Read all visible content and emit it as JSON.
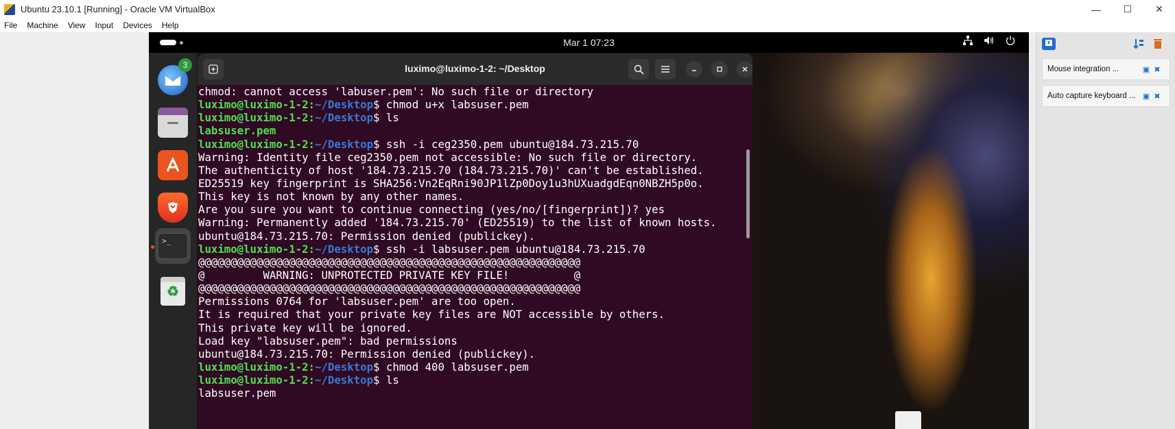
{
  "host_window": {
    "title": "Ubuntu 23.10.1 [Running] - Oracle VM VirtualBox",
    "controls": [
      "—",
      "☐",
      "✕"
    ]
  },
  "host_menu": [
    "File",
    "Machine",
    "View",
    "Input",
    "Devices",
    "Help"
  ],
  "guest_topbar": {
    "clock": "Mar 1  07:23",
    "tray_icons": [
      "network-icon",
      "volume-icon",
      "power-icon"
    ]
  },
  "dock": {
    "items": [
      {
        "name": "thunderbird",
        "badge": "3"
      },
      {
        "name": "files"
      },
      {
        "name": "app-center"
      },
      {
        "name": "brave-browser"
      },
      {
        "name": "terminal",
        "active": true
      },
      {
        "name": "trash"
      }
    ]
  },
  "terminal": {
    "title": "luximo@luximo-1-2: ~/Desktop",
    "prompt_user": "luximo@luximo-1-2",
    "prompt_path": "~/Desktop",
    "lines": [
      {
        "type": "out",
        "text": "chmod: cannot access 'labuser.pem': No such file or directory"
      },
      {
        "type": "cmd",
        "text": " chmod u+x labsuser.pem"
      },
      {
        "type": "cmd",
        "text": " ls"
      },
      {
        "type": "file",
        "text": "labsuser.pem"
      },
      {
        "type": "cmd",
        "text": " ssh -i ceg2350.pem ubuntu@184.73.215.70"
      },
      {
        "type": "out",
        "text": "Warning: Identity file ceg2350.pem not accessible: No such file or directory."
      },
      {
        "type": "out",
        "text": "The authenticity of host '184.73.215.70 (184.73.215.70)' can't be established."
      },
      {
        "type": "out",
        "text": "ED25519 key fingerprint is SHA256:Vn2EqRni90JP1lZp0Doy1u3hUXuadgdEqn0NBZH5p0o."
      },
      {
        "type": "out",
        "text": "This key is not known by any other names."
      },
      {
        "type": "out",
        "text": "Are you sure you want to continue connecting (yes/no/[fingerprint])? yes"
      },
      {
        "type": "out",
        "text": "Warning: Permanently added '184.73.215.70' (ED25519) to the list of known hosts."
      },
      {
        "type": "out",
        "text": "ubuntu@184.73.215.70: Permission denied (publickey)."
      },
      {
        "type": "cmd",
        "text": " ssh -i labsuser.pem ubuntu@184.73.215.70"
      },
      {
        "type": "out",
        "text": "@@@@@@@@@@@@@@@@@@@@@@@@@@@@@@@@@@@@@@@@@@@@@@@@@@@@@@@@@@@"
      },
      {
        "type": "out",
        "text": "@         WARNING: UNPROTECTED PRIVATE KEY FILE!          @"
      },
      {
        "type": "out",
        "text": "@@@@@@@@@@@@@@@@@@@@@@@@@@@@@@@@@@@@@@@@@@@@@@@@@@@@@@@@@@@"
      },
      {
        "type": "out",
        "text": "Permissions 0764 for 'labsuser.pem' are too open."
      },
      {
        "type": "out",
        "text": "It is required that your private key files are NOT accessible by others."
      },
      {
        "type": "out",
        "text": "This private key will be ignored."
      },
      {
        "type": "out",
        "text": "Load key \"labsuser.pem\": bad permissions"
      },
      {
        "type": "out",
        "text": "ubuntu@184.73.215.70: Permission denied (publickey)."
      },
      {
        "type": "cmd",
        "text": " chmod 400 labsuser.pem"
      },
      {
        "type": "cmd",
        "text": " ls"
      },
      {
        "type": "out",
        "text": "labsuser.pem"
      }
    ]
  },
  "vbox_panel": {
    "items": [
      {
        "label": "Mouse integration ..."
      },
      {
        "label": "Auto capture keyboard ..."
      }
    ]
  },
  "colors": {
    "terminal_bg": "#300a24",
    "prompt_user": "#4ee14e",
    "prompt_path": "#3a78d6",
    "accent": "#e95420"
  }
}
